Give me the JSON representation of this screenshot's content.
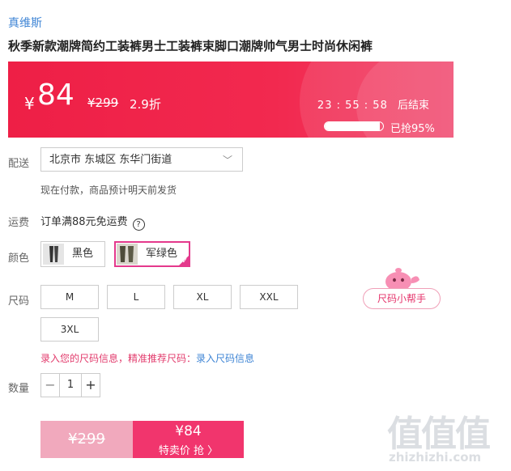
{
  "brand": "真维斯",
  "product_title": "秋季新款潮牌简约工装裤男士工装裤束脚口潮牌帅气男士时尚休闲裤",
  "banner": {
    "currency": "¥",
    "price": "84",
    "original_price": "¥299",
    "discount": "2.9折",
    "countdown": "23 : 55 : 58",
    "countdown_suffix": "后结束",
    "sold_text": "已抢95%",
    "sold_percent": 95
  },
  "delivery": {
    "label": "配送",
    "address": "北京市 东城区 东华门街道",
    "note": "现在付款，商品预计明天前发货"
  },
  "shipping": {
    "label": "运费",
    "text": "订单满88元免运费",
    "help_glyph": "?"
  },
  "color": {
    "label": "颜色",
    "options": [
      {
        "name": "黑色",
        "selected": false
      },
      {
        "name": "军绿色",
        "selected": true
      }
    ]
  },
  "size": {
    "label": "尺码",
    "options": [
      "M",
      "L",
      "XL",
      "XXL",
      "3XL"
    ],
    "helper_label": "尺码小帮手",
    "tip_text": "录入您的尺码信息，精准推荐尺码：",
    "tip_link": "录入尺码信息"
  },
  "quantity": {
    "label": "数量",
    "value": "1",
    "minus": "−",
    "plus": "+"
  },
  "buy": {
    "original_price": "¥299",
    "price": "¥84",
    "action": "特卖价 抢 〉"
  },
  "watermark": {
    "logo_text": "值值值",
    "site": "zhizhizhi.com"
  },
  "colors": {
    "accent": "#f1356d",
    "banner": "#ee1f46",
    "link": "#3f85d5",
    "tip": "#e23b6c"
  }
}
